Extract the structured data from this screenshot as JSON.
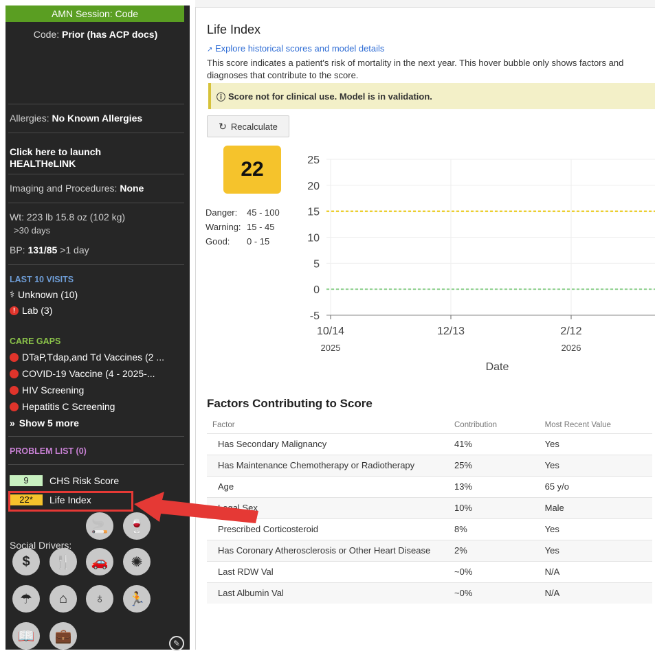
{
  "sidebar": {
    "session": "AMN Session: Code",
    "code_label": "Code:",
    "code_value": "Prior (has ACP docs)",
    "allergies_label": "Allergies:",
    "allergies_value": "No Known Allergies",
    "launch_line1": "Click here to launch",
    "launch_line2": "HEALTHeLINK",
    "imaging_label": "Imaging and Procedures:",
    "imaging_value": "None",
    "wt_label": "Wt:",
    "wt_value": "223 lb 15.8 oz (102 kg)",
    "wt_age": ">30 days",
    "bp_label": "BP:",
    "bp_value": "131/85",
    "bp_age": ">1 day",
    "visits_heading": "LAST 10 VISITS",
    "visits": [
      {
        "icon": "stethoscope-icon",
        "label": "Unknown (10)"
      },
      {
        "icon": "alert-icon",
        "label": "Lab (3)"
      }
    ],
    "care_gaps_heading": "CARE GAPS",
    "care_gaps": [
      "DTaP,Tdap,and Td Vaccines (2 ...",
      "COVID-19 Vaccine (4 - 2025-...",
      "HIV Screening",
      "Hepatitis C Screening"
    ],
    "show_more": "Show 5 more",
    "problem_list": "PROBLEM LIST (0)",
    "chs_score": "9",
    "chs_label": "CHS Risk Score",
    "life_score": "22*",
    "life_label": "Life Index",
    "social_drivers": "Social Drivers:",
    "social_icons": [
      "smoking-icon",
      "alcohol-icon",
      "money-icon",
      "food-icon",
      "transportation-icon",
      "stress-icon",
      "housing-insecurity-icon",
      "housing-icon",
      "safety-icon",
      "physical-activity-icon",
      "education-icon",
      "employment-icon"
    ],
    "colors": {
      "session_bg": "#5a9e22",
      "chs_bg": "#c8f0c0",
      "life_bg": "#f5c32c"
    }
  },
  "panel": {
    "title": "Life Index",
    "explore_link": "Explore historical scores and model details",
    "description": "This score indicates a patient's risk of mortality in the next year. This hover bubble only shows factors and diagnoses that contribute to the score.",
    "banner": "Score not for clinical use. Model is in validation.",
    "recalculate": "Recalculate",
    "score": "22",
    "ranges": [
      {
        "label": "Danger:",
        "value": "45 - 100"
      },
      {
        "label": "Warning:",
        "value": "15 - 45"
      },
      {
        "label": "Good:",
        "value": "0 - 15"
      }
    ],
    "factors_heading": "Factors Contributing to Score",
    "factors_columns": [
      "Factor",
      "Contribution",
      "Most Recent Value"
    ],
    "factors": [
      {
        "factor": "Has Secondary Malignancy",
        "contribution": "41%",
        "value": "Yes"
      },
      {
        "factor": "Has Maintenance Chemotherapy or Radiotherapy",
        "contribution": "25%",
        "value": "Yes"
      },
      {
        "factor": "Age",
        "contribution": "13%",
        "value": "65 y/o"
      },
      {
        "factor": "Legal Sex",
        "contribution": "10%",
        "value": "Male"
      },
      {
        "factor": "Prescribed Corticosteroid",
        "contribution": "8%",
        "value": "Yes"
      },
      {
        "factor": "Has Coronary Atherosclerosis or Other Heart Disease",
        "contribution": "2%",
        "value": "Yes"
      },
      {
        "factor": "Last RDW Val",
        "contribution": "~0%",
        "value": "N/A"
      },
      {
        "factor": "Last Albumin Val",
        "contribution": "~0%",
        "value": "N/A"
      }
    ]
  },
  "chart_data": {
    "type": "line",
    "xlabel": "Date",
    "ylabel": "",
    "ylim": [
      -5,
      25
    ],
    "yticks": [
      25,
      20,
      15,
      10,
      5,
      0,
      -5
    ],
    "xticks": [
      {
        "label": "10/14",
        "year": "2025"
      },
      {
        "label": "12/13",
        "year": ""
      },
      {
        "label": "2/12",
        "year": "2026"
      }
    ],
    "thresholds": [
      {
        "value": 15,
        "color": "#e8c400"
      },
      {
        "value": 0,
        "color": "#8fd18f"
      }
    ],
    "series": [],
    "grid": true
  }
}
